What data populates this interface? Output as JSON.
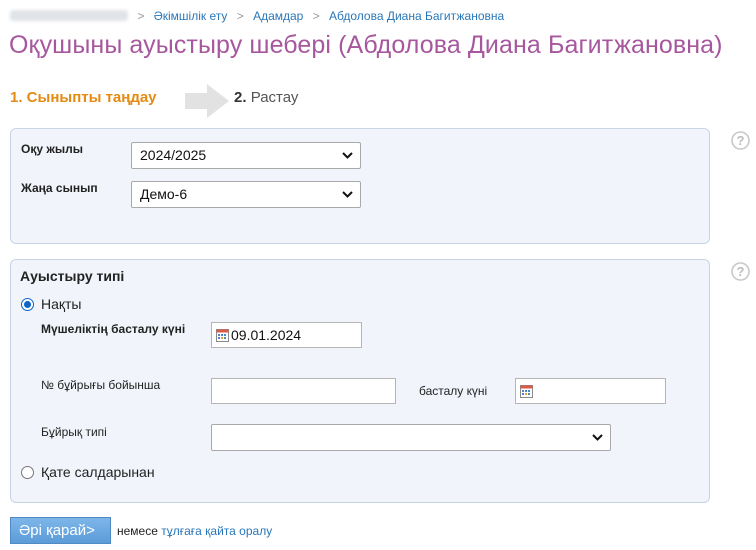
{
  "breadcrumb": {
    "items": [
      "Әкімшілік ету",
      "Адамдар",
      "Абдолова Диана Багитжановна"
    ],
    "separator": ">"
  },
  "page_title": "Оқушыны ауыстыру шебері (Абдолова Диана Багитжановна)",
  "steps": {
    "step1": "1. Сыныпты таңдау",
    "step2_num": "2.",
    "step2_label": "Растау"
  },
  "class_panel": {
    "year_label": "Оқу жылы",
    "year_value": "2024/2025",
    "class_label": "Жаңа сынып",
    "class_value": "Демо-6"
  },
  "transfer_panel": {
    "title": "Ауыстыру типі",
    "option_exact": "Нақты",
    "membership_start_label": "Мүшеліктің басталу күні",
    "membership_start_value": "09.01.2024",
    "order_number_label": "№ бұйрығы бойынша",
    "order_number_value": "",
    "start_date_label": "басталу күні",
    "start_date_value": "",
    "order_type_label": "Бұйрық типі",
    "order_type_value": "",
    "option_error": "Қате салдарынан"
  },
  "footer": {
    "next_button": "Әрі қарай>",
    "or_text": "немесе",
    "back_link": "тұлғаға қайта оралу"
  },
  "colors": {
    "title": "#a7579d",
    "step_active": "#e58a12",
    "link": "#2a77b8",
    "panel_bg": "#f1f5fb",
    "button": "#6aa6e0"
  }
}
